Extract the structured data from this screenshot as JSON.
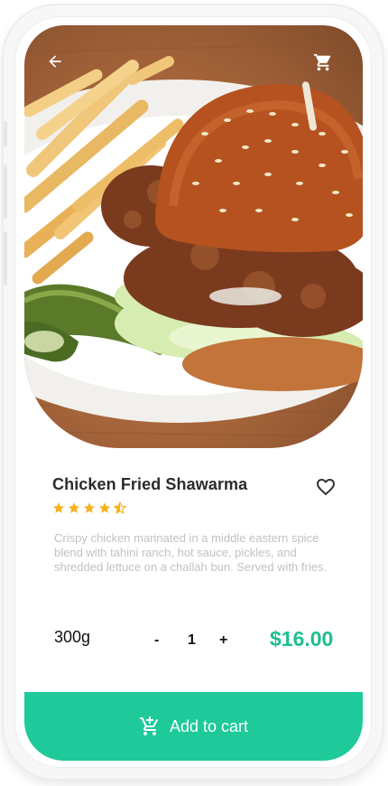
{
  "header": {
    "back_icon": "arrow-left-icon",
    "cart_icon": "shopping-cart-icon"
  },
  "product": {
    "name": "Chicken Fried Shawarma",
    "rating": 4.5,
    "rating_max": 5,
    "description": "Crispy chicken marinated in a middle eastern spice blend with tahini ranch, hot sauce, pickles, and shredded lettuce on a challah bun. Served with fries.",
    "weight": "300g",
    "price": "$16.00",
    "favorite_icon": "heart-outline-icon"
  },
  "quantity": {
    "minus_label": "-",
    "value": "1",
    "plus_label": "+"
  },
  "cta": {
    "label": "Add to cart",
    "icon": "cart-plus-icon"
  },
  "colors": {
    "accent": "#1ec99a",
    "price": "#1ebf8f",
    "star": "#f5b21b",
    "description": "#c2c2c2"
  }
}
